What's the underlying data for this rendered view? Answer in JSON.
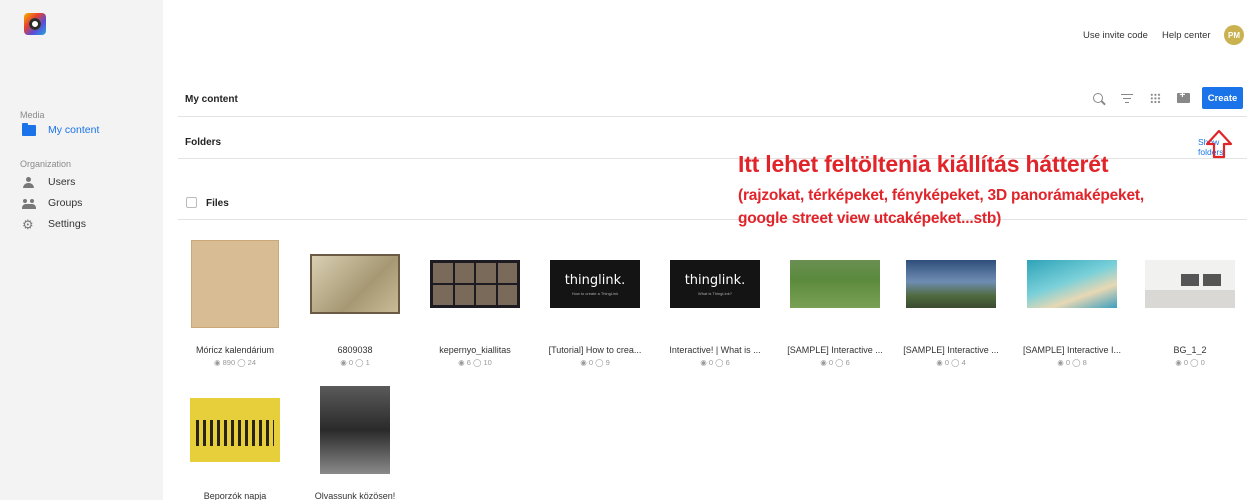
{
  "sidebar": {
    "media_label": "Media",
    "my_content": "My content",
    "organization_label": "Organization",
    "users": "Users",
    "groups": "Groups",
    "settings": "Settings"
  },
  "topbar": {
    "invite": "Use invite code",
    "help": "Help center",
    "avatar_initials": "PM"
  },
  "content": {
    "title": "My content",
    "create": "Create",
    "folders_title": "Folders",
    "show_folders": "Show folders",
    "files_title": "Files"
  },
  "annotation": {
    "title": "Itt lehet feltöltenia kiállítás hátterét",
    "line1": "(rajzokat, térképeket, fényképeket, 3D panorámaképeket,",
    "line2": "google street view utcaképeket...stb)",
    "color": "#e0242a"
  },
  "files": [
    {
      "title": "Móricz kalendárium",
      "stats": "◉ 890 ◯ 24"
    },
    {
      "title": "6809038",
      "stats": "◉ 0 ◯ 1"
    },
    {
      "title": "kepernyo_kiallitas",
      "stats": "◉ 6 ◯ 10"
    },
    {
      "title": "[Tutorial] How to crea...",
      "stats": "◉ 0 ◯ 9",
      "brand": "thinglink.",
      "sub": "How to create a ThingLink"
    },
    {
      "title": "Interactive! | What is ...",
      "stats": "◉ 0 ◯ 6",
      "brand": "thinglink.",
      "sub": "What is ThingLink?"
    },
    {
      "title": "[SAMPLE] Interactive ...",
      "stats": "◉ 0 ◯ 6"
    },
    {
      "title": "[SAMPLE] Interactive ...",
      "stats": "◉ 0 ◯ 4"
    },
    {
      "title": "[SAMPLE] Interactive I...",
      "stats": "◉ 0 ◯ 8"
    },
    {
      "title": "BG_1_2",
      "stats": "◉ 0 ◯ 0"
    },
    {
      "title": "Beporzók napja",
      "stats": ""
    },
    {
      "title": "Olvassunk közösen!",
      "stats": ""
    }
  ],
  "accent_color": "#1a73e8"
}
